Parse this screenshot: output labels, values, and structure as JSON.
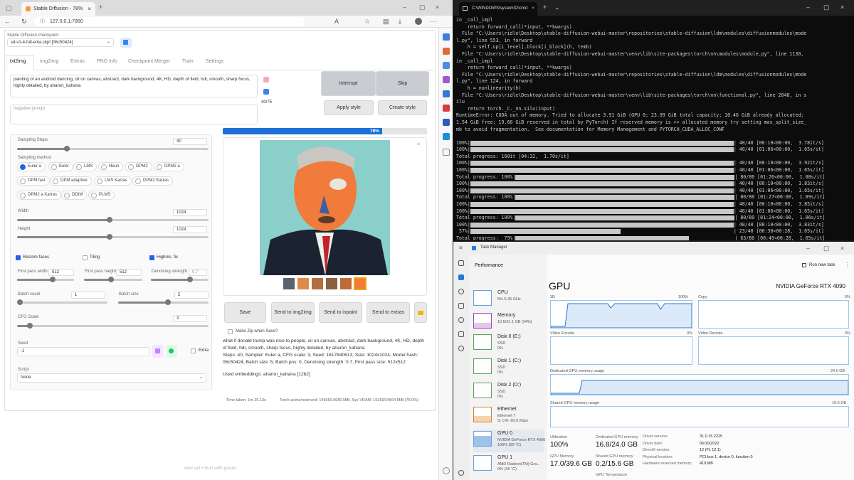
{
  "browser": {
    "tab_title": "Stable Diffusion - 78%",
    "address": "127.0.0.1:7860",
    "checkpoint_label": "Stable Diffusion checkpoint",
    "checkpoint_value": "sd-v1-4-full-ema.ckpt [06c50424]",
    "tabs": [
      "txt2img",
      "img2img",
      "Extras",
      "PNG Info",
      "Checkpoint Merger",
      "Train",
      "Settings"
    ],
    "prompt": "painting of an android dancing, oil on canvas, abstract, dark background, 4K, HD, depth of field, hdr, smooth, sharp focus, highly detailed, by aharon_kahana",
    "negative_placeholder": "Negative prompt",
    "token_count": "40/75",
    "interrupt": "Interrupt",
    "skip": "Skip",
    "apply_style": "Apply style",
    "create_style": "Create style",
    "progress_text": "78%",
    "progress": 0.78,
    "sampling_steps_label": "Sampling Steps",
    "sampling_steps": "40",
    "sampling_method_label": "Sampling method",
    "methods": [
      "Euler a",
      "Euler",
      "LMS",
      "Heun",
      "DPM2",
      "DPM2 a",
      "DPM fast",
      "DPM adaptive",
      "LMS Karras",
      "DPM2 Karras",
      "DPM2 a Karras",
      "DDIM",
      "PLMS"
    ],
    "width_label": "Width",
    "width": "1024",
    "height_label": "Height",
    "height": "1024",
    "restore_faces": "Restore faces",
    "tiling": "Tiling",
    "highres": "Highres. fix",
    "fp_width_label": "First pass width",
    "fp_width": "512",
    "fp_height_label": "First pass height",
    "fp_height": "512",
    "denoise_label": "Denoising strength",
    "denoise": "0.7",
    "batch_count_label": "Batch count",
    "batch_count": "1",
    "batch_size_label": "Batch size",
    "batch_size": "5",
    "cfg_label": "CFG Scale",
    "cfg": "3",
    "seed_label": "Seed",
    "seed": "-1",
    "extra": "Extra",
    "script_label": "Script",
    "script": "None",
    "save": "Save",
    "send_img2img": "Send to img2img",
    "send_inpaint": "Send to inpaint",
    "send_extras": "Send to extras",
    "make_zip": "Make Zip when Save?",
    "info_text": "what if donald trump was nice to people, oil on canvas, abstract, dark background, 4K, HD, depth of field, hdr, smooth, sharp focus, highly detailed, by aharon_kahana",
    "info_params": "Steps: 40, Sampler: Euler a, CFG scale: 3, Seed: 1617640613, Size: 1024x1024, Model hash: 06c50424, Batch size: 5, Batch pos: 0, Denoising strength: 0.7, First pass size: 512x512",
    "embeddings": "Used embeddings: aharon_kahana [12b2]",
    "time_taken": "Time taken: 1m 25.13s",
    "vram": "Torch active/reserved: 14665/16080 MiB, Sys VRAM: 19159/24564 MiB (78.0%)",
    "footer": "view api • built with gradio"
  },
  "cmd": {
    "tab_title": "C:\\WINDOWS\\system32\\cmd",
    "lines": [
      "in _call_impl",
      "    return forward_call(*input, **kwargs)",
      "  File \"C:\\Users\\ridle\\Desktop\\stable-diffusion-webui-master\\repositories\\stable-diffusion\\ldm\\modules\\diffusionmodules\\mode",
      "l.py\", line 553, in forward",
      "    h = self.up[i_level].block[i_block](h, temb)",
      "  File \"C:\\Users\\ridle\\Desktop\\stable-diffusion-webui-master\\venv\\lib\\site-packages\\torch\\nn\\modules\\module.py\", line 1130,",
      "in _call_impl",
      "    return forward_call(*input, **kwargs)",
      "  File \"C:\\Users\\ridle\\Desktop\\stable-diffusion-webui-master\\repositories\\stable-diffusion\\ldm\\modules\\diffusionmodules\\mode",
      "l.py\", line 124, in forward",
      "    h = nonlinearity(h)",
      "  File \"C:\\Users\\ridle\\Desktop\\stable-diffusion-webui-master\\venv\\lib\\site-packages\\torch\\nn\\functional.py\", line 2048, in s",
      "ilu",
      "    return torch._C._nn.silu(input)",
      "RuntimeError: CUDA out of memory. Tried to allocate 3.91 GiB (GPU 0; 23.99 GiB total capacity; 10.46 GiB already allocated;",
      "1.54 GiB free; 19.60 GiB reserved in total by PyTorch) If reserved memory is >> allocated memory try setting max_split_size_",
      "mb to avoid fragmentation.  See documentation for Memory Management and PYTORCH_CUDA_ALLOC_CONF"
    ],
    "bars": [
      {
        "pre": "100%|",
        "fill": 1.0,
        "post": "| 40/40 [00:10<00:00,  3.78it/s]"
      },
      {
        "pre": "100%|",
        "fill": 1.0,
        "post": "| 40/40 [01:06<00:00,  1.65s/it]"
      },
      {
        "pre": "Total progress: 160it [04:32,  1.70s/it]",
        "fill": -1,
        "post": ""
      },
      {
        "pre": "100%|",
        "fill": 1.0,
        "post": "| 40/40 [00:10<00:00,  3.92it/s]"
      },
      {
        "pre": "100%|",
        "fill": 1.0,
        "post": "| 40/40 [01:06<00:00,  1.65s/it]"
      },
      {
        "pre": "Total progress: 100%|",
        "fill": 1.0,
        "post": "| 80/80 [01:26<00:00,  1.08s/it]"
      },
      {
        "pre": "100%|",
        "fill": 1.0,
        "post": "| 40/40 [00:10<00:00,  3.83it/s]"
      },
      {
        "pre": "100%|",
        "fill": 1.0,
        "post": "| 40/40 [01:06<00:00,  1.65s/it]"
      },
      {
        "pre": "Total progress: 100%|",
        "fill": 1.0,
        "post": "| 80/80 [01:27<00:00,  1.09s/it]"
      },
      {
        "pre": "100%|",
        "fill": 1.0,
        "post": "| 40/40 [00:10<00:00,  3.85it/s]"
      },
      {
        "pre": "100%|",
        "fill": 1.0,
        "post": "| 40/40 [01:06<00:00,  1.65s/it]"
      },
      {
        "pre": "Total progress: 100%|",
        "fill": 1.0,
        "post": "| 80/80 [01:24<00:00,  1.06s/it]"
      },
      {
        "pre": "100%|",
        "fill": 1.0,
        "post": "| 40/40 [00:10<00:00,  3.83it/s]"
      },
      {
        "pre": " 57%|",
        "fill": 0.57,
        "post": "| 23/40 [00:38<00:28,  1.65s/it]"
      },
      {
        "pre": "Total progress:  79%|",
        "fill": 0.79,
        "post": "| 63/80 [00:49<00:28,  1.65s/it]"
      }
    ]
  },
  "taskmgr": {
    "title": "Task Manager",
    "section": "Performance",
    "run_new_task": "Run new task",
    "items": [
      {
        "name": "CPU",
        "sub": "5% 5.36 GHz"
      },
      {
        "name": "Memory",
        "sub": "10.5/31.1 GB (34%)"
      },
      {
        "name": "Disk 0 (E:)",
        "sub": "SSD",
        "sub2": "0%"
      },
      {
        "name": "Disk 1 (C:)",
        "sub": "SSD",
        "sub2": "0%"
      },
      {
        "name": "Disk 2 (D:)",
        "sub": "SSD",
        "sub2": "0%"
      },
      {
        "name": "Ethernet",
        "sub": "Ethernet 7",
        "sub2": "S: 0 R: 80.0 Kbps"
      },
      {
        "name": "GPU 0",
        "sub": "NVIDIA GeForce RTX 4090",
        "sub2": "100% (59 °C)"
      },
      {
        "name": "GPU 1",
        "sub": "AMD Radeon(TM) Gra...",
        "sub2": "0% (36 °C)"
      }
    ],
    "gpu_title": "GPU",
    "gpu_model": "NVIDIA GeForce RTX 4090",
    "g3d": "3D",
    "g3d_pct": "100%",
    "copy": "Copy",
    "copy_pct": "0%",
    "zero": "0%",
    "venc": "Video Encode",
    "vdec": "Video Decode",
    "dedicated": "Dedicated GPU memory usage",
    "dedicated_max": "24.0 GB",
    "shared": "Shared GPU memory usage",
    "shared_max": "15.6 GB",
    "util_l": "Utilization",
    "util_v": "100%",
    "ded_l": "Dedicated GPU memory",
    "ded_v": "16.8/24.0 GB",
    "gpumem_l": "GPU Memory",
    "gpumem_v": "17.0/39.6 GB",
    "shr_l": "Shared GPU memory",
    "shr_v": "0.2/15.6 GB",
    "temp_l": "GPU Temperature",
    "drv_l": [
      "Driver version:",
      "Driver date:",
      "DirectX version:",
      "Physical location:",
      "Hardware reserved memory:"
    ],
    "drv_v": [
      "31.0.15.2225",
      "06/10/2022",
      "12 (FL 12.1)",
      "PCI bus 1, device 0, function 0",
      "419 MB"
    ]
  },
  "colors": {
    "accent": "#2563eb",
    "progress_blue": "#1d6fd8",
    "tm_blue": "#1f7ad6"
  }
}
